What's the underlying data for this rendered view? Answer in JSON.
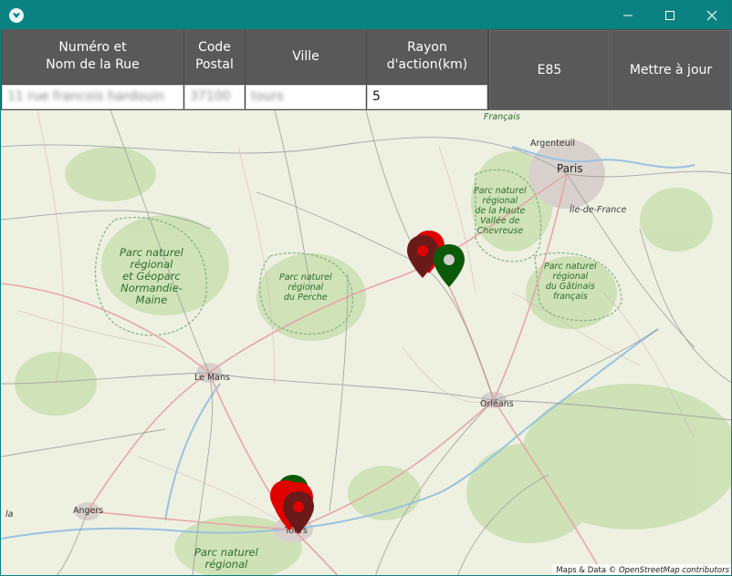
{
  "form": {
    "street_header": "Numéro et\nNom de la Rue",
    "postal_header": "Code\nPostal",
    "city_header": "Ville",
    "radius_header": "Rayon\nd'action(km)",
    "street_value": "11 rue francois hardouin",
    "postal_value": "37100",
    "city_value": "tours",
    "radius_value": "5"
  },
  "buttons": {
    "fuel": "E85",
    "update": "Mettre à jour"
  },
  "map": {
    "cities": {
      "paris": "Paris",
      "argenteuil": "Argenteuil",
      "lemans": "Le Mans",
      "orleans": "Orléans",
      "angers": "Angers",
      "tours": "Tours",
      "la": "la",
      "francais": "Français",
      "idf": "Île-de-France"
    },
    "parks": {
      "normandie": "Parc naturel\nrégional\net Géoparc\nNormandie-\nMaine",
      "perche": "Parc naturel\nrégional\ndu Perche",
      "chevreuse": "Parc naturel\nrégional\nde la Haute\nVallée de\nChevreuse",
      "gatinais": "Parc naturel\nrégional\ndu Gâtinais\nfrançais",
      "south": "Parc naturel\nrégional"
    },
    "attribution_prefix": "Maps & Data © ",
    "attribution_source": "OpenStreetMap contributors"
  },
  "colors": {
    "titlebar": "#0b8282",
    "header": "#595959",
    "pin_red": "#e00000",
    "pin_dark_red": "#6b1a1a",
    "pin_green": "#0a5a0a"
  }
}
